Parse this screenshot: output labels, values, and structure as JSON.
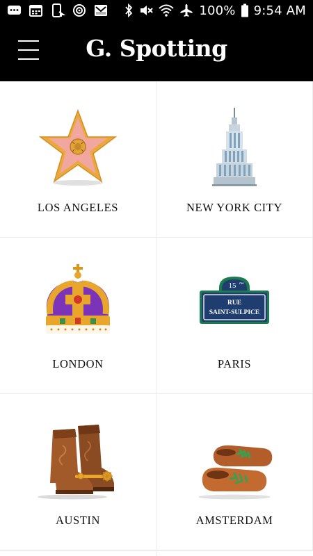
{
  "status_bar": {
    "battery_percent": "100%",
    "time": "9:54 AM",
    "left_icons": [
      "chat-icon",
      "calendar-icon",
      "phone-sync-icon",
      "target-icon",
      "mail-icon"
    ],
    "right_icons": [
      "bluetooth-icon",
      "mute-icon",
      "wifi-icon",
      "airplane-icon",
      "battery-icon"
    ]
  },
  "header": {
    "title": "G. Spotting",
    "menu_icon": "hamburger-icon"
  },
  "cities": [
    {
      "label": "LOS ANGELES",
      "icon": "hollywood-star-icon"
    },
    {
      "label": "NEW YORK CITY",
      "icon": "empire-state-building-icon"
    },
    {
      "label": "LONDON",
      "icon": "crown-icon"
    },
    {
      "label": "PARIS",
      "icon": "street-sign-icon",
      "sign_number": "15",
      "sign_suffix": "me",
      "sign_line1": "RUE",
      "sign_line2": "SAINT-SULPICE"
    },
    {
      "label": "AUSTIN",
      "icon": "cowboy-boots-icon"
    },
    {
      "label": "AMSTERDAM",
      "icon": "wooden-clogs-icon"
    }
  ],
  "colors": {
    "header_bg": "#000000",
    "status_bar_bg": "#000000",
    "text": "#111111"
  }
}
